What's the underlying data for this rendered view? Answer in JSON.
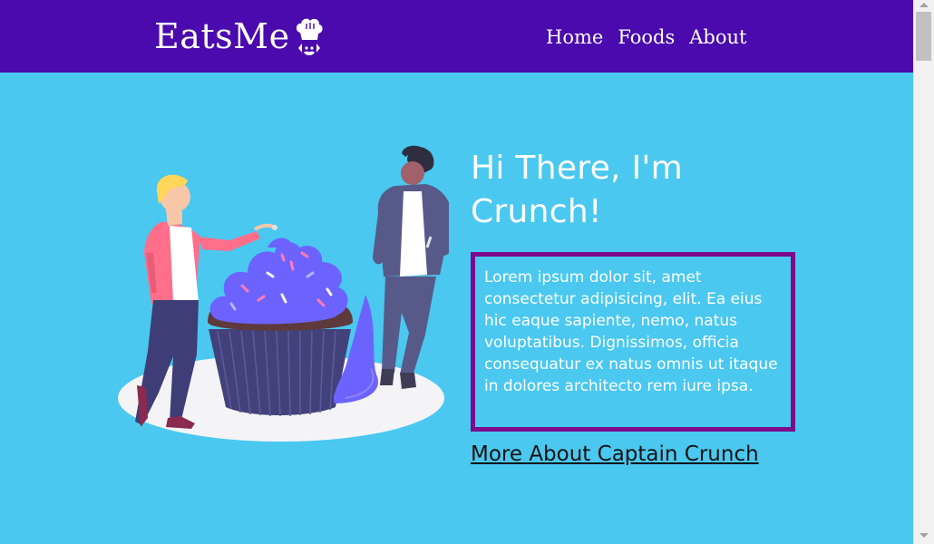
{
  "navbar": {
    "brand": "EatsMe",
    "brand_icon": "chef-hat-icon",
    "links": [
      {
        "label": "Home"
      },
      {
        "label": "Foods"
      },
      {
        "label": "About"
      }
    ],
    "background": "#4a0aad"
  },
  "hero": {
    "title": "Hi There, I'm Crunch!",
    "description": "Lorem ipsum dolor sit, amet consectetur adipisicing, elit. Ea eius hic eaque sapiente, nemo, natus voluptatibus. Dignissimos, officia consequatur ex natus omnis ut itaque in dolores architecto rem iure ipsa.",
    "link": "More About Captain Crunch",
    "illustration": "cupcake-people-illustration",
    "background": "#4ac8f0",
    "box_border": "#7b0a8c"
  }
}
